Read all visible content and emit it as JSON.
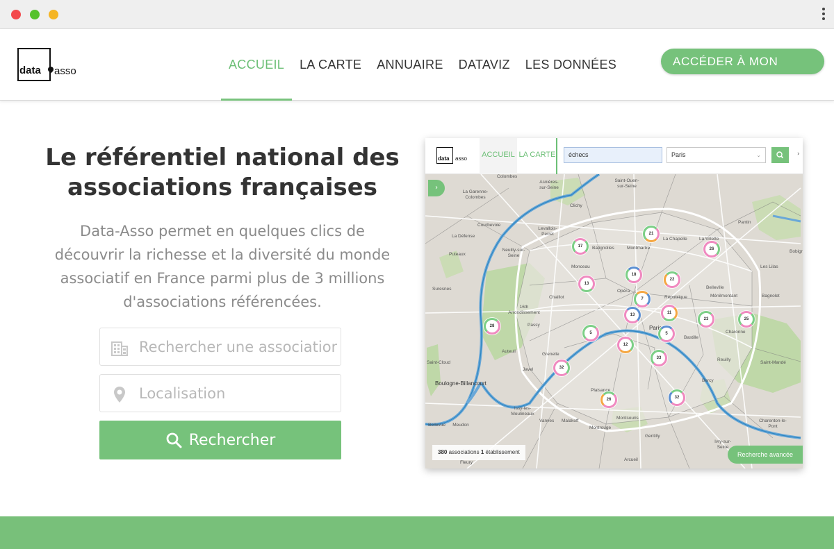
{
  "window": {
    "controls": [
      "close",
      "minimize",
      "maximize"
    ]
  },
  "header": {
    "logo": {
      "word1": "data",
      "word2": "asso"
    },
    "nav": [
      {
        "label": "ACCUEIL",
        "active": true
      },
      {
        "label": "LA CARTE",
        "active": false
      },
      {
        "label": "ANNUAIRE",
        "active": false
      },
      {
        "label": "DATAVIZ",
        "active": false
      },
      {
        "label": "LES DONNÉES",
        "active": false
      }
    ],
    "access_button": "ACCÉDER À MON"
  },
  "hero": {
    "title_line1": "Le référentiel national des",
    "title_line2": "associations françaises",
    "desc_line1": "Data-Asso permet en quelques clics de",
    "desc_line2": "découvrir la richesse et la diversité du monde",
    "desc_line3": "associatif en France parmi plus de 3 millions",
    "desc_line4": "d'associations référencées."
  },
  "search": {
    "association_placeholder": "Rechercher une association",
    "location_placeholder": "Localisation",
    "button_label": "Rechercher"
  },
  "preview": {
    "logo": {
      "word1": "data",
      "word2": "asso"
    },
    "tabs": [
      "ACCUEIL",
      "LA CARTE"
    ],
    "query_value": "échecs",
    "location_value": "Paris",
    "status_count": "380",
    "status_text_1": "associations",
    "status_count_2": "1",
    "status_text_2": "établissement",
    "advanced_label": "Recherche avancée",
    "places": [
      "Colombes",
      "Asnières-sur-Seine",
      "Saint-Ouen-sur-Seine",
      "La Garenne-Colombes",
      "Clichy",
      "Courbevoie",
      "La Défense",
      "Levallois-Perret",
      "Batignolles",
      "Montmartre",
      "La Chapelle",
      "La Villette",
      "Pantin",
      "Puteaux",
      "Neuilly-sur-Seine",
      "Monceau",
      "Les Lilas",
      "Suresnes",
      "Chaillot",
      "Opéra",
      "République",
      "Belleville",
      "Ménilmontant",
      "Bagnolet",
      "16th Arrondissement",
      "Passy",
      "Paris",
      "Bastille",
      "Charonne",
      "Auteuil",
      "Grenelle",
      "Javel",
      "Reuilly",
      "Saint-Mandé",
      "Saint-Cloud",
      "Boulogne-Billancourt",
      "Bercy",
      "Plaisance",
      "Issy-les-Moulineaux",
      "Vanves",
      "Malakoff",
      "Montrouge",
      "Montsouris",
      "Gentilly",
      "Ivry-sur-Seine",
      "Charenton-le-Pont",
      "Bellevue",
      "Meudon",
      "Arcueil",
      "Fleury",
      "Bobigny"
    ],
    "clusters": [
      "17",
      "21",
      "26",
      "18",
      "22",
      "13",
      "7",
      "13",
      "11",
      "23",
      "25",
      "28",
      "5",
      "12",
      "5",
      "33",
      "32",
      "26",
      "32"
    ]
  }
}
